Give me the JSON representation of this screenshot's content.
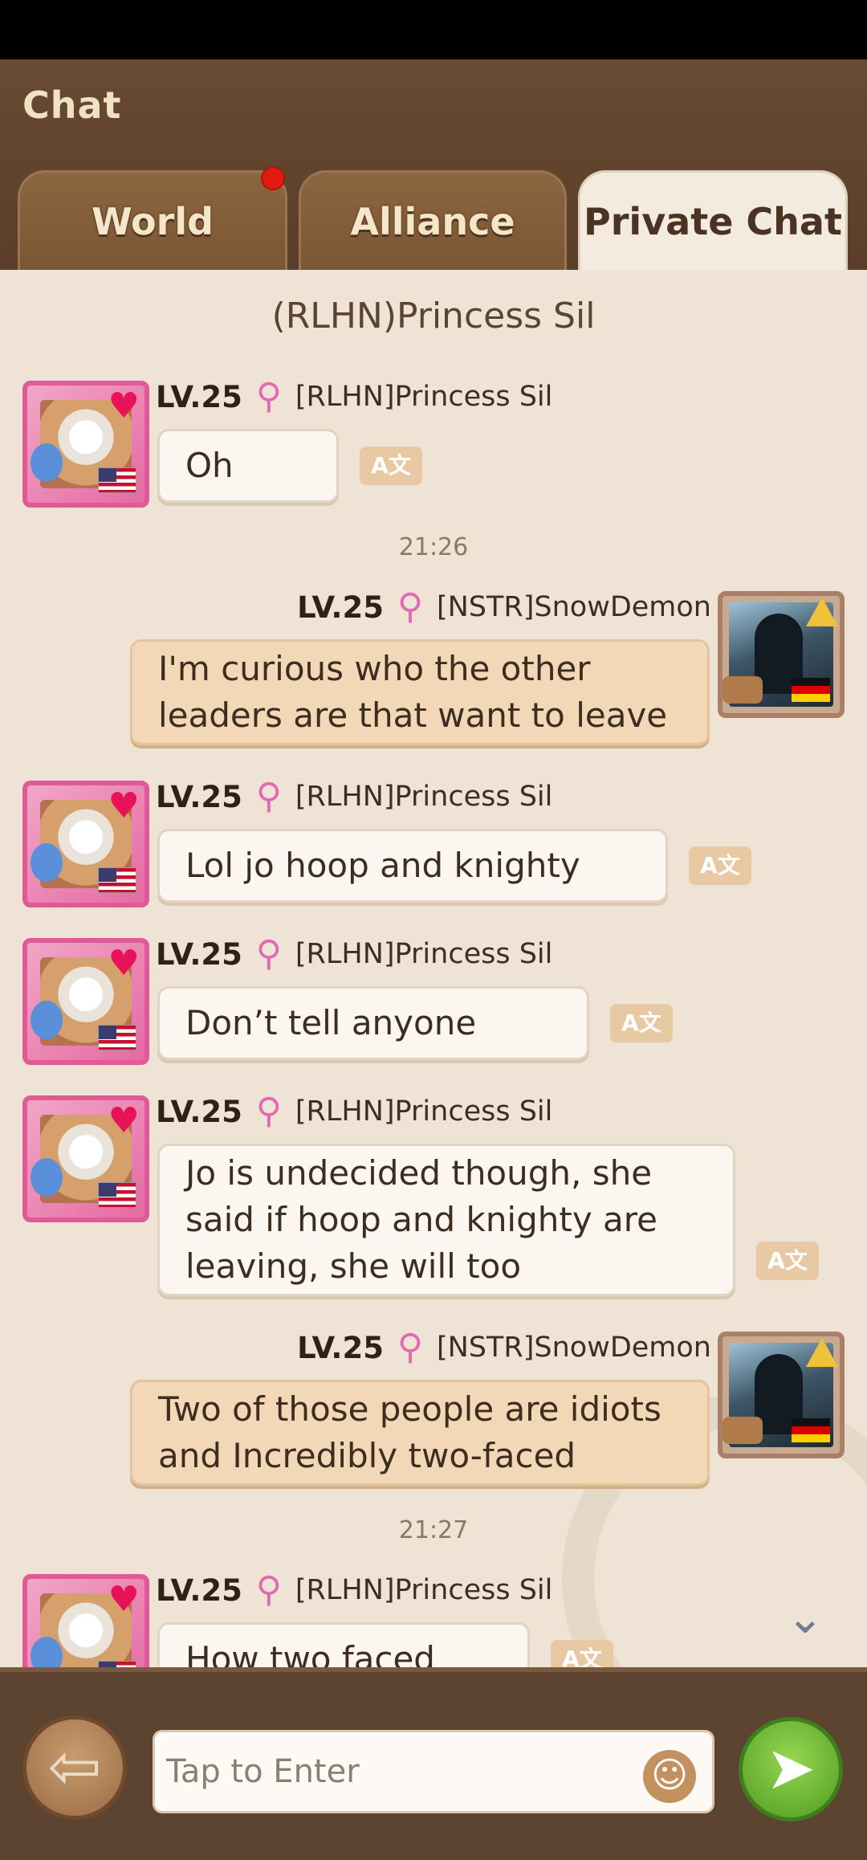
{
  "header": {
    "title": "Chat"
  },
  "tabs": [
    {
      "label": "World",
      "has_notification": true
    },
    {
      "label": "Alliance",
      "has_notification": false
    },
    {
      "label": "Private Chat",
      "active": true
    }
  ],
  "conversation": {
    "title": "(RLHN)Princess Sil"
  },
  "messages": [
    {
      "level": "LV.25",
      "name": "[RLHN]Princess Sil",
      "text": "Oh"
    },
    {
      "time": "21:26"
    },
    {
      "level": "LV.25",
      "name": "[NSTR]SnowDemon",
      "text": "I'm curious who the other leaders are that want to leave"
    },
    {
      "level": "LV.25",
      "name": "[RLHN]Princess Sil",
      "text": "Lol jo hoop and knighty"
    },
    {
      "level": "LV.25",
      "name": "[RLHN]Princess Sil",
      "text": "Don’t tell anyone"
    },
    {
      "level": "LV.25",
      "name": "[RLHN]Princess Sil",
      "text": "Jo is undecided though, she said if hoop and knighty are leaving, she will too"
    },
    {
      "level": "LV.25",
      "name": "[NSTR]SnowDemon",
      "text": "Two of those people are idiots and Incredibly two-faced"
    },
    {
      "time": "21:27"
    },
    {
      "level": "LV.25",
      "name": "[RLHN]Princess Sil",
      "text": "How two faced"
    }
  ],
  "input": {
    "placeholder": "Tap to Enter"
  },
  "icons": {
    "gender": "female-icon",
    "translate": "translate-icon",
    "scroll": "chevron-down-icon",
    "back": "back-arrow-icon",
    "emoji": "smiley-icon",
    "send": "send-icon"
  },
  "colors": {
    "accent_green": "#5fae2e",
    "notification_red": "#e21b12",
    "gender_pink": "#e16ab4"
  }
}
